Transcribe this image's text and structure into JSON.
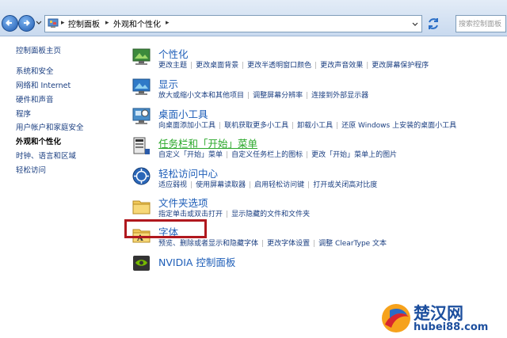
{
  "address": {
    "crumbs": [
      "控制面板",
      "外观和个性化"
    ],
    "search_placeholder": "搜索控制面板"
  },
  "sidebar": {
    "items": [
      {
        "label": "控制面板主页"
      },
      {
        "label": "系统和安全"
      },
      {
        "label": "网络和 Internet"
      },
      {
        "label": "硬件和声音"
      },
      {
        "label": "程序"
      },
      {
        "label": "用户帐户和家庭安全"
      },
      {
        "label": "外观和个性化"
      },
      {
        "label": "时钟、语言和区域"
      },
      {
        "label": "轻松访问"
      }
    ]
  },
  "categories": [
    {
      "title": "个性化",
      "icon": "personalization-icon",
      "links": [
        "更改主题",
        "更改桌面背景",
        "更改半透明窗口颜色",
        "更改声音效果",
        "更改屏幕保护程序"
      ]
    },
    {
      "title": "显示",
      "icon": "display-icon",
      "links": [
        "放大或缩小文本和其他项目",
        "调整屏幕分辨率",
        "连接到外部显示器"
      ]
    },
    {
      "title": "桌面小工具",
      "icon": "gadgets-icon",
      "links": [
        "向桌面添加小工具",
        "联机获取更多小工具",
        "卸载小工具",
        "还原 Windows 上安装的桌面小工具"
      ]
    },
    {
      "title": "任务栏和「开始」菜单",
      "icon": "taskbar-icon",
      "links": [
        "自定义「开始」菜单",
        "自定义任务栏上的图标",
        "更改「开始」菜单上的图片"
      ]
    },
    {
      "title": "轻松访问中心",
      "icon": "ease-of-access-icon",
      "links": [
        "适应弱视",
        "使用屏幕读取器",
        "启用轻松访问键",
        "打开或关闭高对比度"
      ]
    },
    {
      "title": "文件夹选项",
      "icon": "folder-options-icon",
      "links": [
        "指定单击或双击打开",
        "显示隐藏的文件和文件夹"
      ]
    },
    {
      "title": "字体",
      "icon": "fonts-folder-icon",
      "links": [
        "预览、删除或者显示和隐藏字体",
        "更改字体设置",
        "调整 ClearType 文本"
      ]
    },
    {
      "title": "NVIDIA 控制面板",
      "icon": "nvidia-icon",
      "links": []
    }
  ],
  "watermark": {
    "text": "楚汉网",
    "url": "hubei88.com"
  },
  "colors": {
    "link": "#1e5eb8",
    "hover_title": "#2aa82a",
    "highlight": "#b0181e"
  }
}
